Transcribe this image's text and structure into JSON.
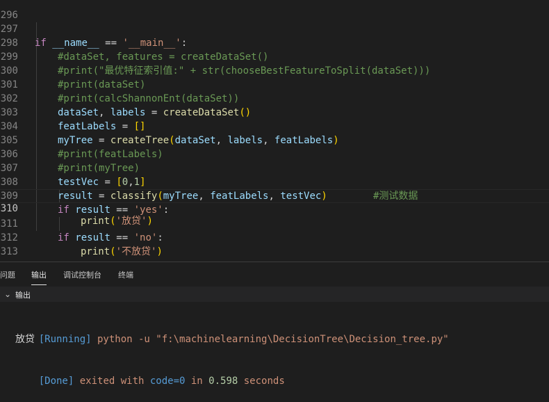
{
  "editor": {
    "line_296": {
      "num": "296"
    },
    "line_297": {
      "num": "297",
      "if": "if",
      "name": "__name__",
      "eq": " == ",
      "main": "'__main__'",
      "colon": ":"
    },
    "line_298": {
      "num": "298",
      "comment": "#dataSet, features = createDataSet()"
    },
    "line_299": {
      "num": "299",
      "comment": "#print(\"最优特征索引值:\" + str(chooseBestFeatureToSplit(dataSet)))"
    },
    "line_300": {
      "num": "300",
      "comment": "#print(dataSet)"
    },
    "line_301": {
      "num": "301",
      "comment": "#print(calcShannonEnt(dataSet))"
    },
    "line_302": {
      "num": "302",
      "v1": "dataSet",
      "comma": ", ",
      "v2": "labels",
      "eq": " = ",
      "fn": "createDataSet",
      "p": "()"
    },
    "line_303": {
      "num": "303",
      "v1": "featLabels",
      "eq": " = ",
      "b": "[]"
    },
    "line_304": {
      "num": "304",
      "v1": "myTree",
      "eq": " = ",
      "fn": "createTree",
      "po": "(",
      "a1": "dataSet",
      "c1": ", ",
      "a2": "labels",
      "c2": ", ",
      "a3": "featLabels",
      "pc": ")"
    },
    "line_305": {
      "num": "305",
      "comment": "#print(featLabels)"
    },
    "line_306": {
      "num": "306",
      "comment": "#print(myTree)"
    },
    "line_307": {
      "num": "307",
      "v1": "testVec",
      "eq": " = ",
      "bo": "[",
      "n1": "0",
      "c": ",",
      "n2": "1",
      "bc": "]",
      "comment": "#测试数据"
    },
    "line_308": {
      "num": "308",
      "v1": "result",
      "eq": " = ",
      "fn": "classify",
      "po": "(",
      "a1": "myTree",
      "c1": ", ",
      "a2": "featLabels",
      "c2": ", ",
      "a3": "testVec",
      "pc": ")"
    },
    "line_309": {
      "num": "309",
      "if": "if",
      "v": "result",
      "eq": " == ",
      "s": "'yes'",
      "colon": ":"
    },
    "line_310": {
      "num": "310",
      "fn": "print",
      "po": "(",
      "s": "'放贷'",
      "pc": ")"
    },
    "line_311": {
      "num": "311",
      "if": "if",
      "v": "result",
      "eq": " == ",
      "s": "'no'",
      "colon": ":"
    },
    "line_312": {
      "num": "312",
      "fn": "print",
      "po": "(",
      "s": "'不放贷'",
      "pc": ")"
    },
    "line_313": {
      "num": "313"
    }
  },
  "panel": {
    "tabs": {
      "problems": "问题",
      "output": "输出",
      "debug_console": "调试控制台",
      "terminal": "终端"
    },
    "output_header": "输出",
    "output": {
      "running_tag": "[Running]",
      "command": " python -u \"f:\\machinelearning\\DecisionTree\\Decision_tree.py\"",
      "result": "放贷",
      "done_tag": "[Done]",
      "exited": " exited with ",
      "code": "code=0",
      "in": " in ",
      "seconds_val": "0.598",
      "seconds": " seconds"
    }
  },
  "colors": {
    "background": "#1e1e1e",
    "keyword": "#c586c0",
    "variable": "#9cdcfe",
    "function": "#dcdcaa",
    "string": "#ce9178",
    "comment": "#6a9955",
    "number": "#b5cea8"
  }
}
